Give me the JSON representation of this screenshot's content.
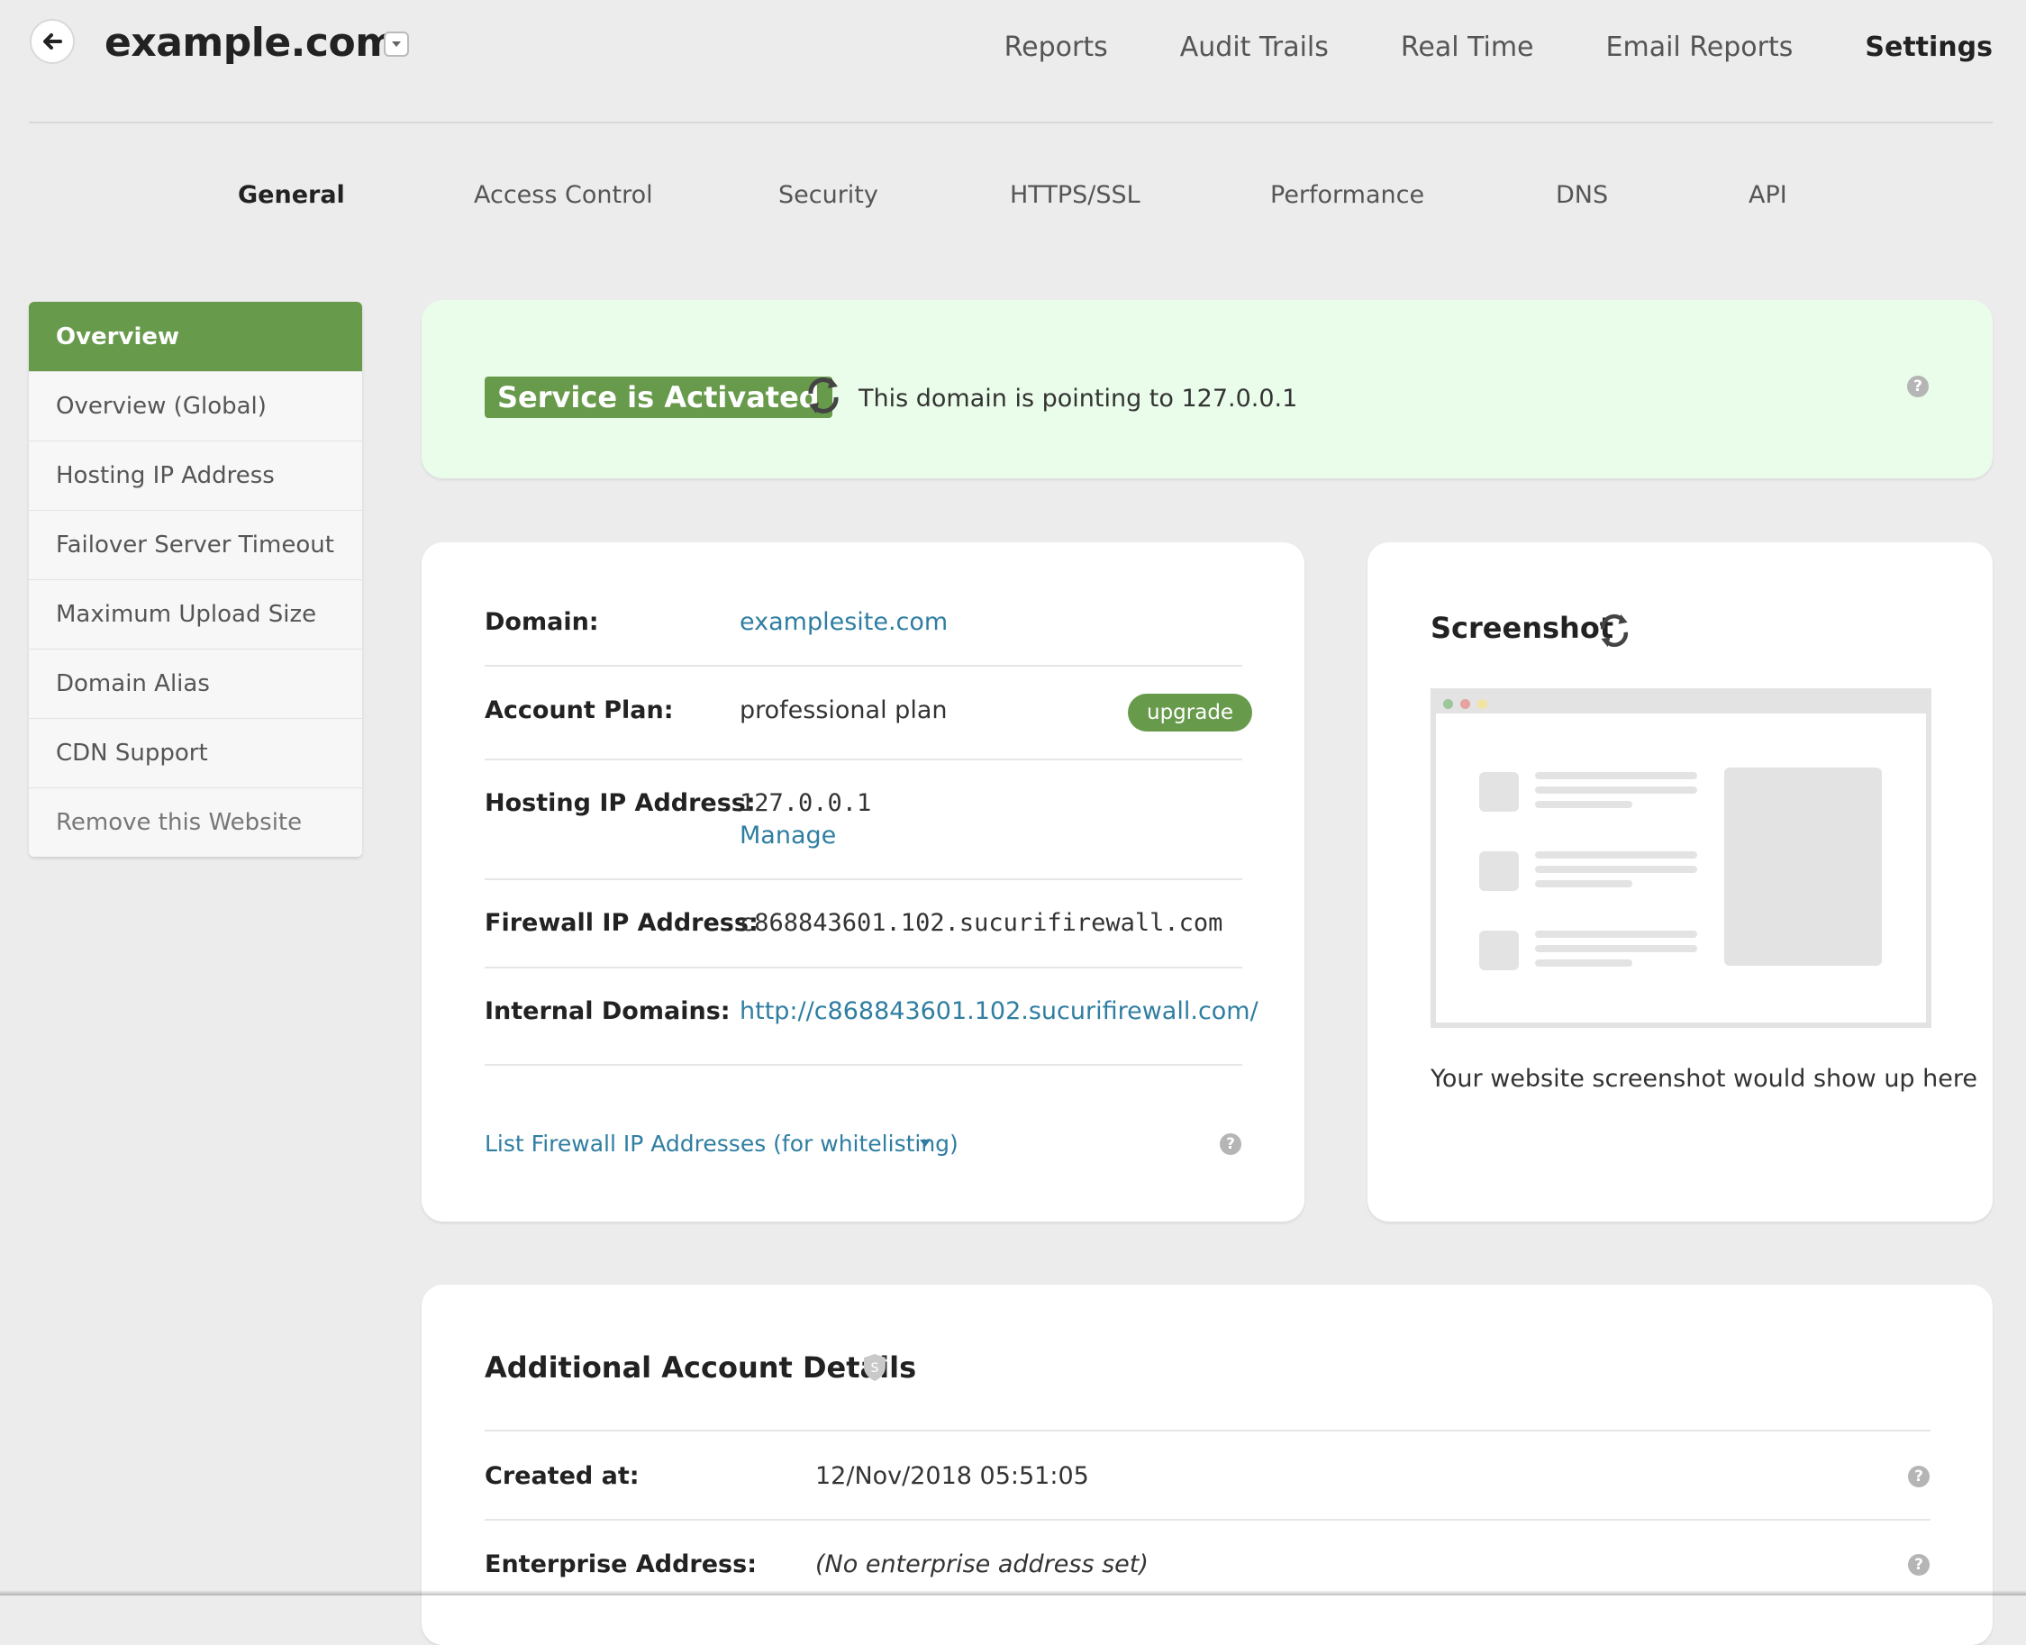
{
  "header": {
    "site_title": "example.com",
    "nav": [
      "Reports",
      "Audit Trails",
      "Real Time",
      "Email Reports",
      "Settings"
    ],
    "active_nav": "Settings"
  },
  "subnav": {
    "tabs": [
      "General",
      "Access Control",
      "Security",
      "HTTPS/SSL",
      "Performance",
      "DNS",
      "API"
    ],
    "active_tab": "General"
  },
  "sidebar": {
    "items": [
      {
        "label": "Overview",
        "active": true
      },
      {
        "label": "Overview (Global)"
      },
      {
        "label": "Hosting IP Address"
      },
      {
        "label": "Failover Server Timeout"
      },
      {
        "label": "Maximum Upload Size"
      },
      {
        "label": "Domain Alias"
      },
      {
        "label": "CDN Support"
      },
      {
        "label": "Remove this Website"
      }
    ]
  },
  "banner": {
    "status": "Service is Activated",
    "pointing": "This domain is pointing to 127.0.0.1"
  },
  "details": {
    "domain_label": "Domain:",
    "domain_value": "examplesite.com",
    "plan_label": "Account Plan:",
    "plan_value": "professional plan",
    "upgrade_label": "upgrade",
    "hosting_ip_label": "Hosting IP Address:",
    "hosting_ip_value": "127.0.0.1",
    "manage_label": "Manage",
    "firewall_ip_label": "Firewall IP Address:",
    "firewall_ip_value": "c868843601.102.sucurifirewall.com",
    "internal_domains_label": "Internal Domains:",
    "internal_domains_value": "http://c868843601.102.sucurifirewall.com/",
    "list_firewall_label": "List Firewall IP Addresses (for whitelisting)"
  },
  "screenshot": {
    "title": "Screenshot",
    "caption": "Your website screenshot would show up here"
  },
  "additional": {
    "title": "Additional Account Details",
    "created_label": "Created at:",
    "created_value": "12/Nov/2018 05:51:05",
    "enterprise_label": "Enterprise Address:",
    "enterprise_value": "(No enterprise address set)"
  },
  "colors": {
    "accent_green": "#689a4c",
    "banner_bg": "#eafdea",
    "link_blue": "#2f7ea1",
    "page_bg": "#ececec"
  },
  "icons": [
    "back-arrow-icon",
    "chevron-down-icon",
    "refresh-icon",
    "help-icon",
    "caret-down-icon",
    "shield-icon"
  ]
}
